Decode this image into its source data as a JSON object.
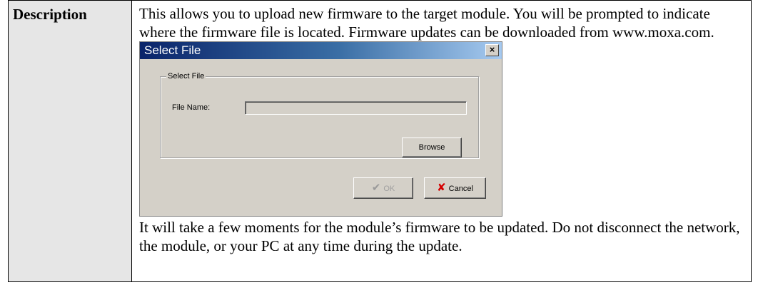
{
  "label": "Description",
  "intro": "This allows you to upload new firmware to the target module. You will be prompted to indicate where the firmware file is located. Firmware updates can be downloaded from www.moxa.com.",
  "dialog": {
    "title": "Select File",
    "close_glyph": "×",
    "group_label": "Select File",
    "file_name_label": "File Name:",
    "file_name_value": "",
    "browse_label": "Browse",
    "ok_label": "OK",
    "cancel_label": "Cancel",
    "ok_icon": "check-icon",
    "cancel_icon": "x-icon"
  },
  "outro": "It will take a few moments for the module’s firmware to be updated. Do not disconnect the network, the module, or your PC at any time during the update."
}
